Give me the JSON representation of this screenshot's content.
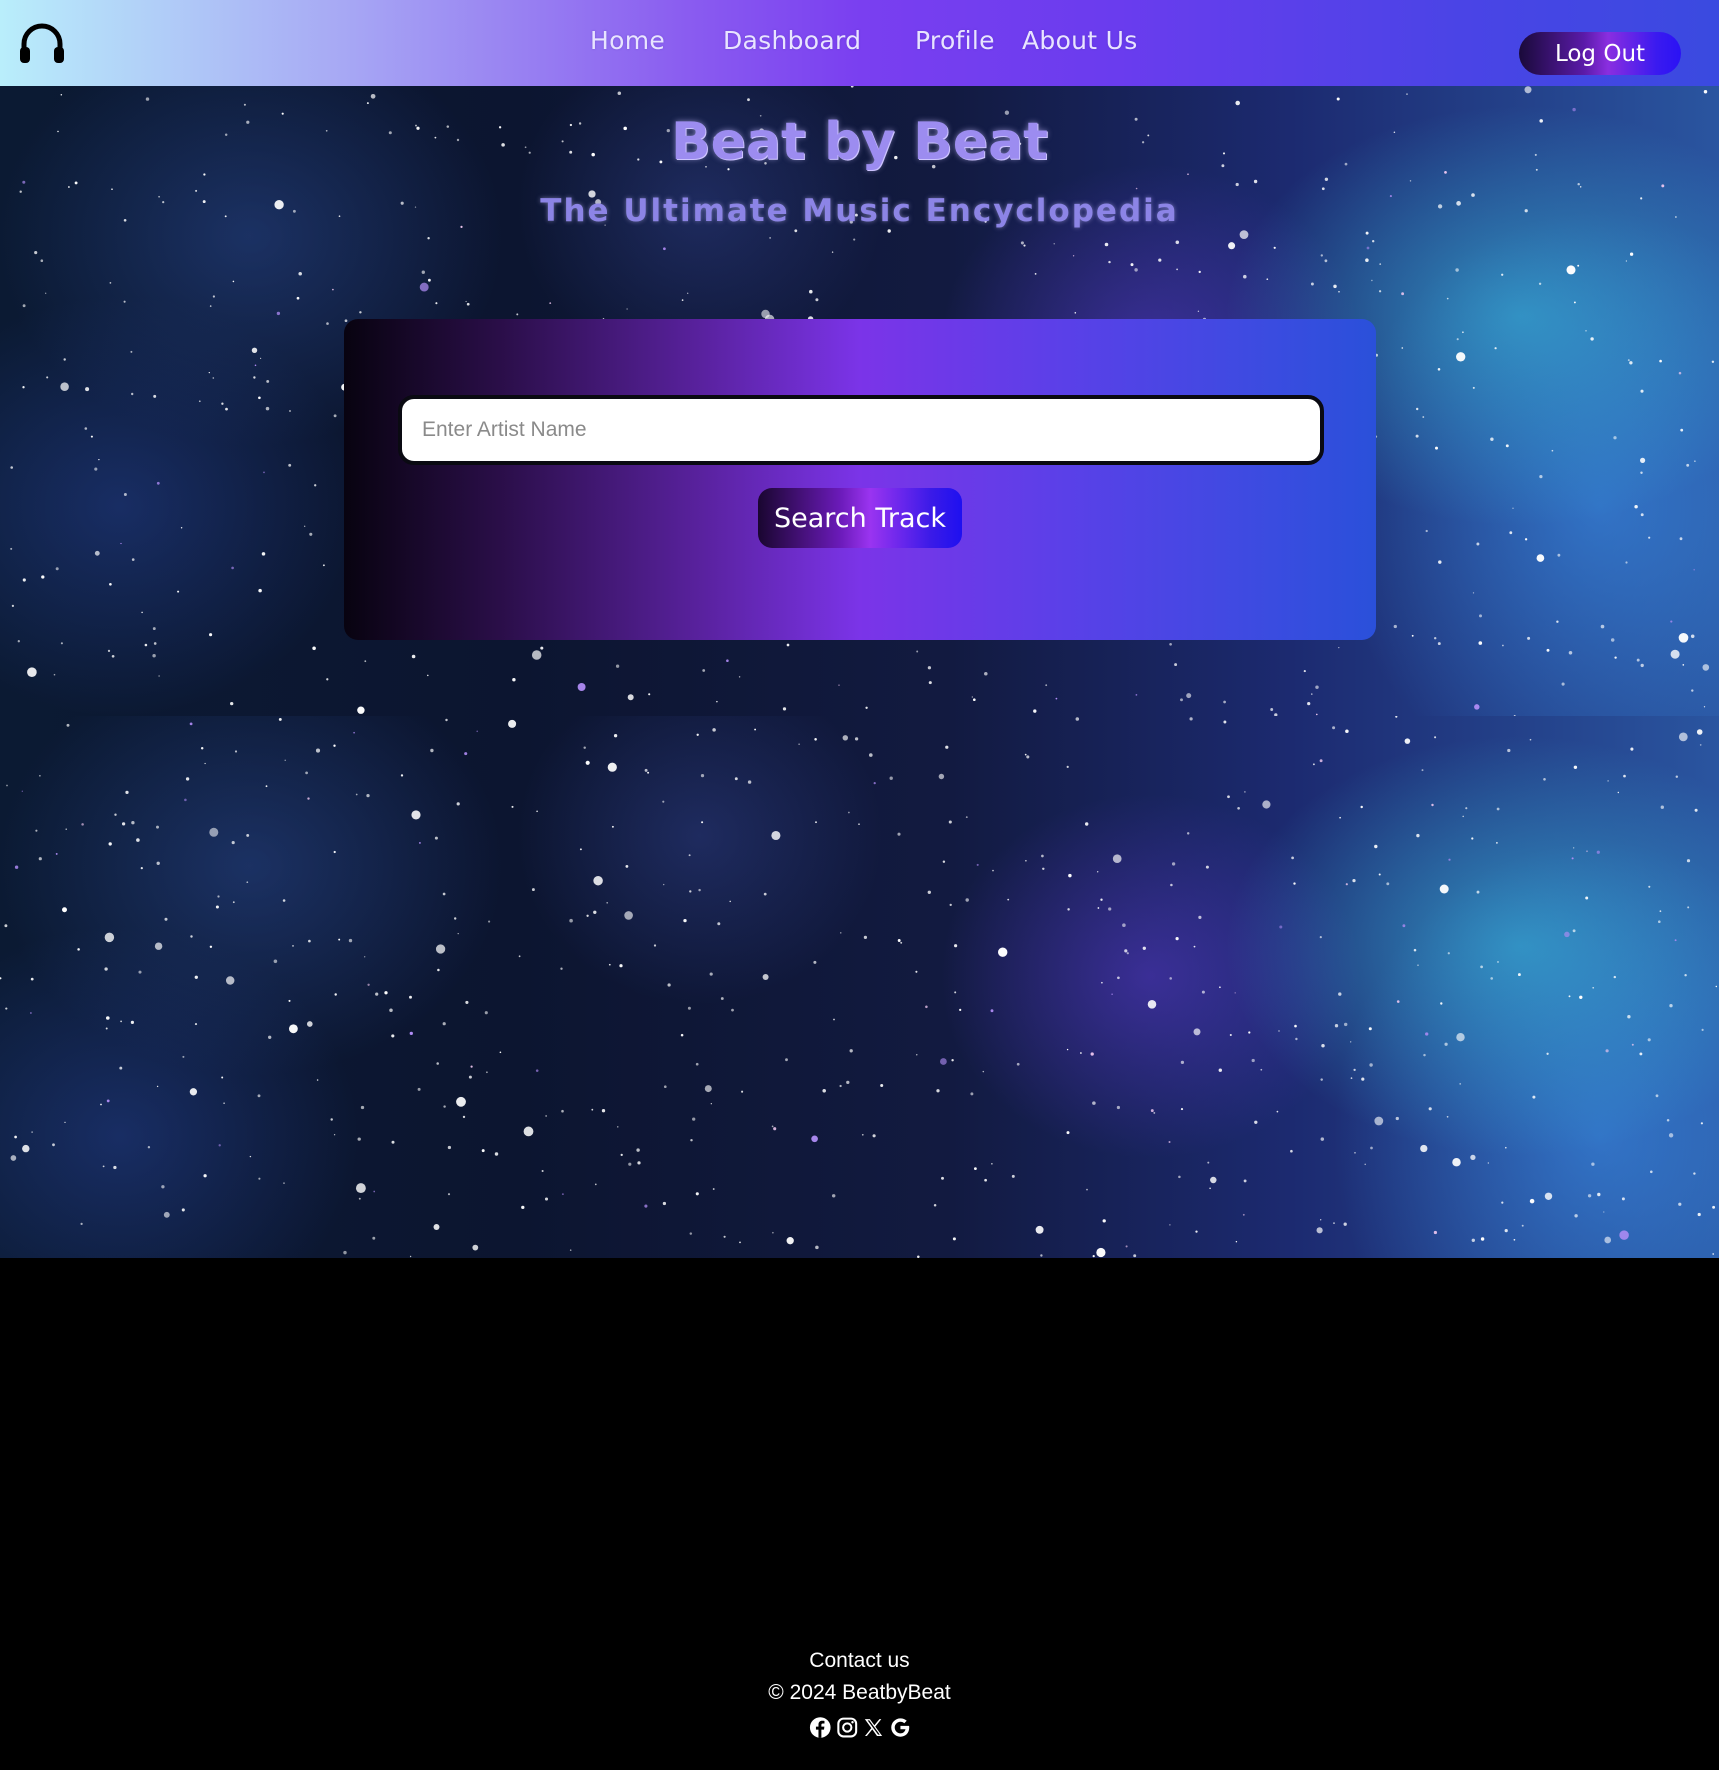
{
  "header": {
    "logo_icon": "headphones-icon",
    "nav": {
      "home": "Home",
      "dashboard": "Dashboard",
      "profile": "Profile",
      "about": "About Us"
    },
    "logout_label": "Log Out"
  },
  "hero": {
    "title": "Beat by Beat",
    "subtitle": "The Ultimate Music Encyclopedia"
  },
  "search": {
    "placeholder": "Enter Artist Name",
    "value": "",
    "button_label": "Search Track"
  },
  "footer": {
    "contact": "Contact us",
    "copyright": "© 2024 BeatbyBeat",
    "social_icons": [
      "facebook-icon",
      "instagram-icon",
      "x-icon",
      "google-icon"
    ]
  },
  "colors": {
    "header_gradient_start": "#b9eefb",
    "header_gradient_mid": "#7a3ff0",
    "header_gradient_end": "#3a4ae0",
    "title": "#9c8cf0",
    "footer_bg": "#000000"
  }
}
